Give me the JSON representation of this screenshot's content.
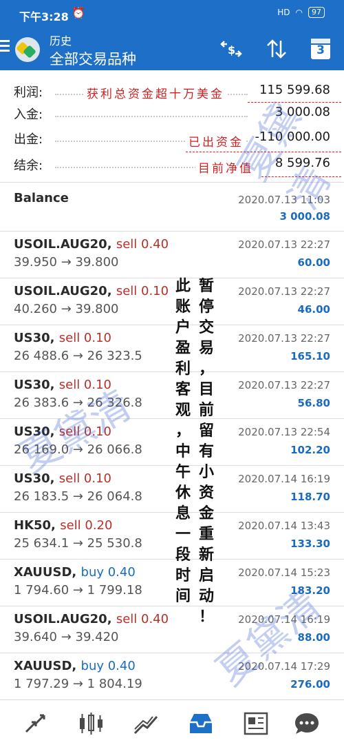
{
  "status": {
    "time": "下午3:28",
    "battery": "97",
    "signal": "HD"
  },
  "appbar": {
    "subtitle": "历史",
    "title": "全部交易品种",
    "calendar_day": "3"
  },
  "summary": [
    {
      "label": "利润:",
      "value": "115 599.68"
    },
    {
      "label": "入金:",
      "value": "3 000.08"
    },
    {
      "label": "出金:",
      "value": "-110 000.00"
    },
    {
      "label": "结余:",
      "value": "8 599.76"
    }
  ],
  "annotations": {
    "profit": "获利总资金超十万美金",
    "withdraw": "已出资金",
    "equity": "目前净值",
    "vertical_right": [
      "暂",
      "停",
      "交",
      "易",
      "，",
      "目",
      "前",
      "留",
      "有",
      "小",
      "资",
      "金",
      "重",
      "新",
      "启",
      "动",
      "！"
    ],
    "vertical_left": [
      "此",
      "账",
      "户",
      "盈",
      "利",
      "客",
      "观",
      "，",
      "中",
      "午",
      "休",
      "息",
      "一",
      "段",
      "时",
      "间"
    ],
    "watermark": "夏黛清"
  },
  "balance_entry": {
    "label": "Balance",
    "date": "2020.07.13 11:03",
    "amount": "3 000.08"
  },
  "deals": [
    {
      "symbol": "USOIL.AUG20,",
      "side": "sell 0.40",
      "type": "sell",
      "prices": "39.950 → 39.800",
      "date": "2020.07.13 22:27",
      "profit": "60.00"
    },
    {
      "symbol": "USOIL.AUG20,",
      "side": "sell 0.10",
      "type": "sell",
      "prices": "40.260 → 39.800",
      "date": "2020.07.13 22:27",
      "profit": "46.00"
    },
    {
      "symbol": "US30,",
      "side": "sell 0.10",
      "type": "sell",
      "prices": "26 488.6 → 26 323.5",
      "date": "2020.07.13 22:27",
      "profit": "165.10"
    },
    {
      "symbol": "US30,",
      "side": "sell 0.10",
      "type": "sell",
      "prices": "26 383.6 → 26 326.8",
      "date": "2020.07.13 22:27",
      "profit": "56.80"
    },
    {
      "symbol": "US30,",
      "side": "sell 0.10",
      "type": "sell",
      "prices": "26 169.0 → 26 066.8",
      "date": "2020.07.13 22:54",
      "profit": "102.20"
    },
    {
      "symbol": "US30,",
      "side": "sell 0.10",
      "type": "sell",
      "prices": "26 183.5 → 26 064.8",
      "date": "2020.07.14 16:19",
      "profit": "118.70"
    },
    {
      "symbol": "HK50,",
      "side": "sell 0.20",
      "type": "sell",
      "prices": "25 634.1 → 25 530.8",
      "date": "2020.07.14 13:43",
      "profit": "133.30"
    },
    {
      "symbol": "XAUUSD,",
      "side": "buy 0.40",
      "type": "buy",
      "prices": "1 794.60 → 1 799.18",
      "date": "2020.07.14 15:23",
      "profit": "183.20"
    },
    {
      "symbol": "USOIL.AUG20,",
      "side": "sell 0.40",
      "type": "sell",
      "prices": "39.640 → 39.420",
      "date": "2020.07.14 16:19",
      "profit": "88.00"
    },
    {
      "symbol": "XAUUSD,",
      "side": "buy 0.40",
      "type": "buy",
      "prices": "1 797.29 → 1 804.19",
      "date": "2020.07.14 17:29",
      "profit": "276.00"
    }
  ],
  "colors": {
    "primary": "#1d6fc7",
    "sell": "#b8302a",
    "buy": "#1a6bbf",
    "annotation": "#d41f1f"
  },
  "nav_icons": [
    "trade-icon",
    "quotes-chart-icon",
    "analytics-icon",
    "history-icon",
    "news-icon",
    "chat-icon"
  ]
}
